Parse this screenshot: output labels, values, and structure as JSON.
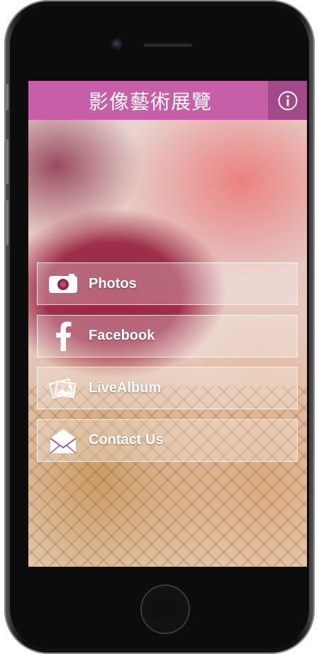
{
  "app": {
    "title": "影像藝術展覽",
    "header_color": "#c75ea8",
    "info_button_color": "#a24a89",
    "info_icon": "info-circle-icon"
  },
  "menu": {
    "items": [
      {
        "label": "Photos",
        "icon": "camera-icon"
      },
      {
        "label": "Facebook",
        "icon": "facebook-icon"
      },
      {
        "label": "LiveAlbum",
        "icon": "photo-album-icon"
      },
      {
        "label": "Contact Us",
        "icon": "envelope-icon"
      }
    ]
  }
}
